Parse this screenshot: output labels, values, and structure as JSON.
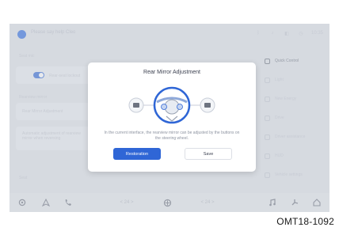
{
  "top_bar": {
    "prompt": "Please say help Cleo",
    "status_items": [
      "ᛒ",
      "♪",
      "◧",
      "◷",
      "10:35"
    ]
  },
  "left_panel": {
    "section_title": "Seat mic",
    "toggle_label": "Rear-seat lockout",
    "rearview_mirror_title": "Rearview mirror",
    "items": [
      {
        "label": "Rear Mirror Adjustment"
      },
      {
        "label": "Automatic adjustment of rearview mirror when reversing"
      }
    ],
    "footer_label": "Seat"
  },
  "right_panel": {
    "items": [
      {
        "label": "Quick Control",
        "active": true
      },
      {
        "label": "Light"
      },
      {
        "label": "New Energy"
      },
      {
        "label": "Drive"
      },
      {
        "label": "Driver assistance"
      },
      {
        "label": "HUD"
      },
      {
        "label": "Vehicle settings"
      }
    ]
  },
  "dialog": {
    "title": "Rear Mirror Adjustment",
    "message": "In the current interface, the rearview mirror can be adjusted by the buttons on the steering wheel.",
    "primary_button": "Restoration",
    "secondary_button": "Save"
  },
  "bottom_bar": {
    "left_temp": "< 24 >",
    "right_temp": "< 24 >"
  },
  "caption": "OMT18-1092"
}
